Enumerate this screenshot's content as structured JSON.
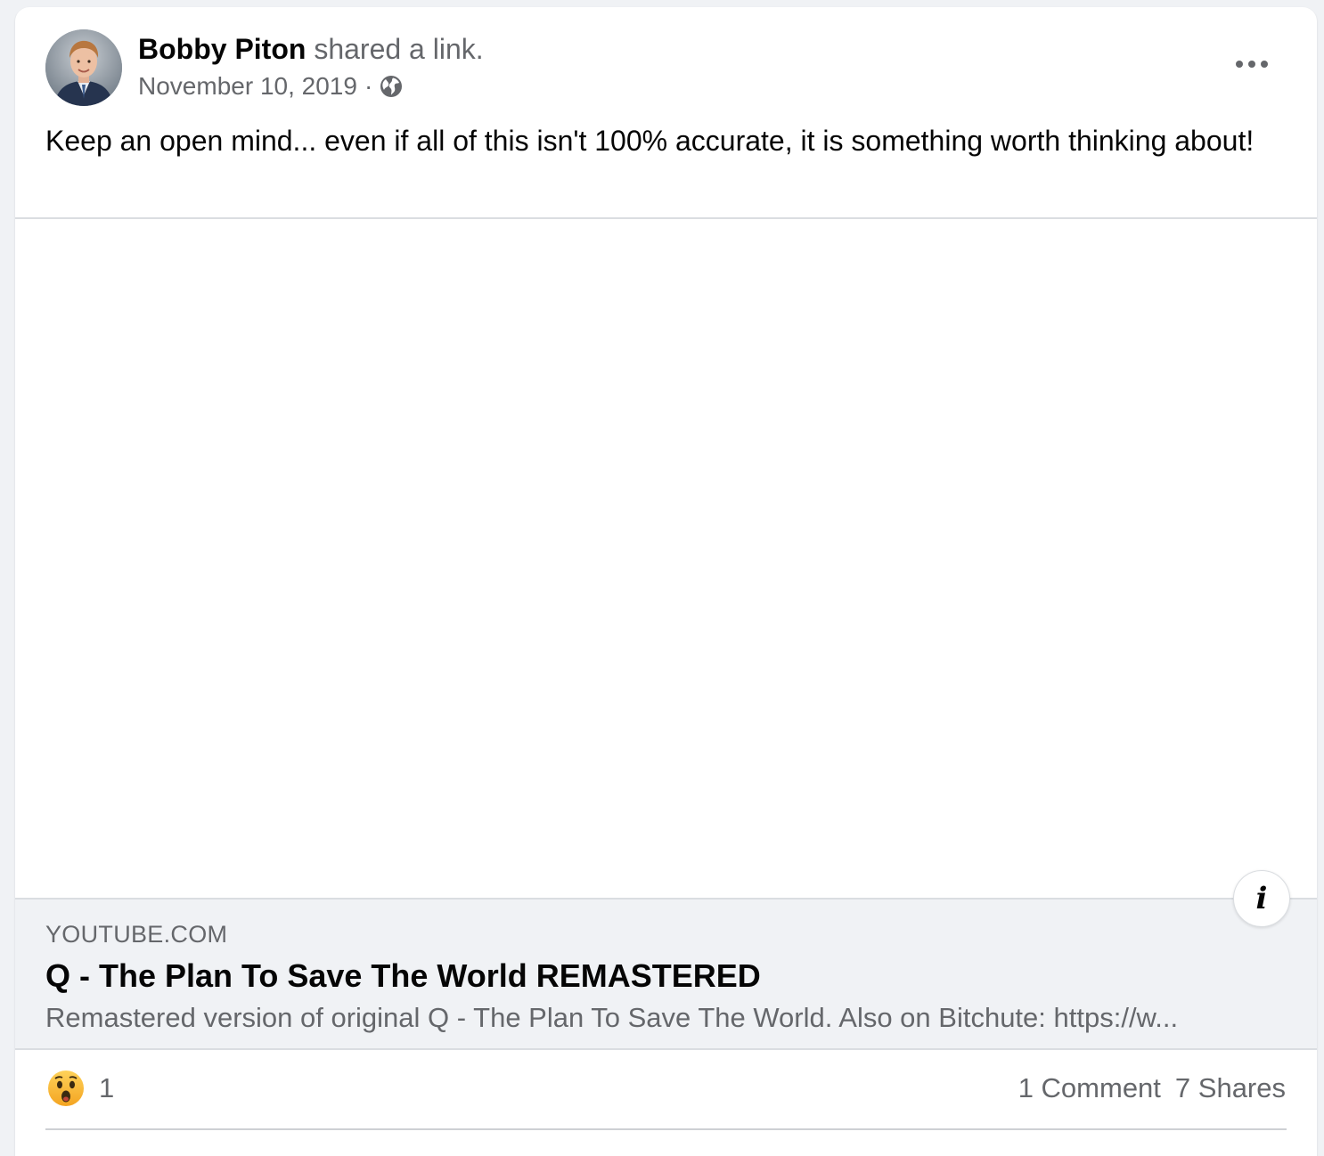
{
  "post": {
    "author": "Bobby Piton",
    "action": "shared a link.",
    "date": "November 10, 2019",
    "separator": "·",
    "privacy_icon": "globe-icon",
    "more_icon": "more-options-icon",
    "text": "Keep an open mind... even if all of this isn't 100% accurate, it is something worth thinking about!"
  },
  "link_preview": {
    "domain": "YOUTUBE.COM",
    "title": "Q - The Plan To Save The World REMASTERED",
    "description": "Remastered version of original Q - The Plan To Save The World. Also on Bitchute: https://w...",
    "info_icon": "info-icon",
    "info_glyph": "i"
  },
  "engagement": {
    "reaction_icon": "wow-reaction-icon",
    "reaction_count": "1",
    "comments": "1 Comment",
    "shares": "7 Shares"
  },
  "colors": {
    "background": "#f0f2f5",
    "card": "#ffffff",
    "primary_text": "#050505",
    "secondary_text": "#65676b",
    "divider": "#dadde1",
    "wow_yellow": "#f7b125"
  }
}
